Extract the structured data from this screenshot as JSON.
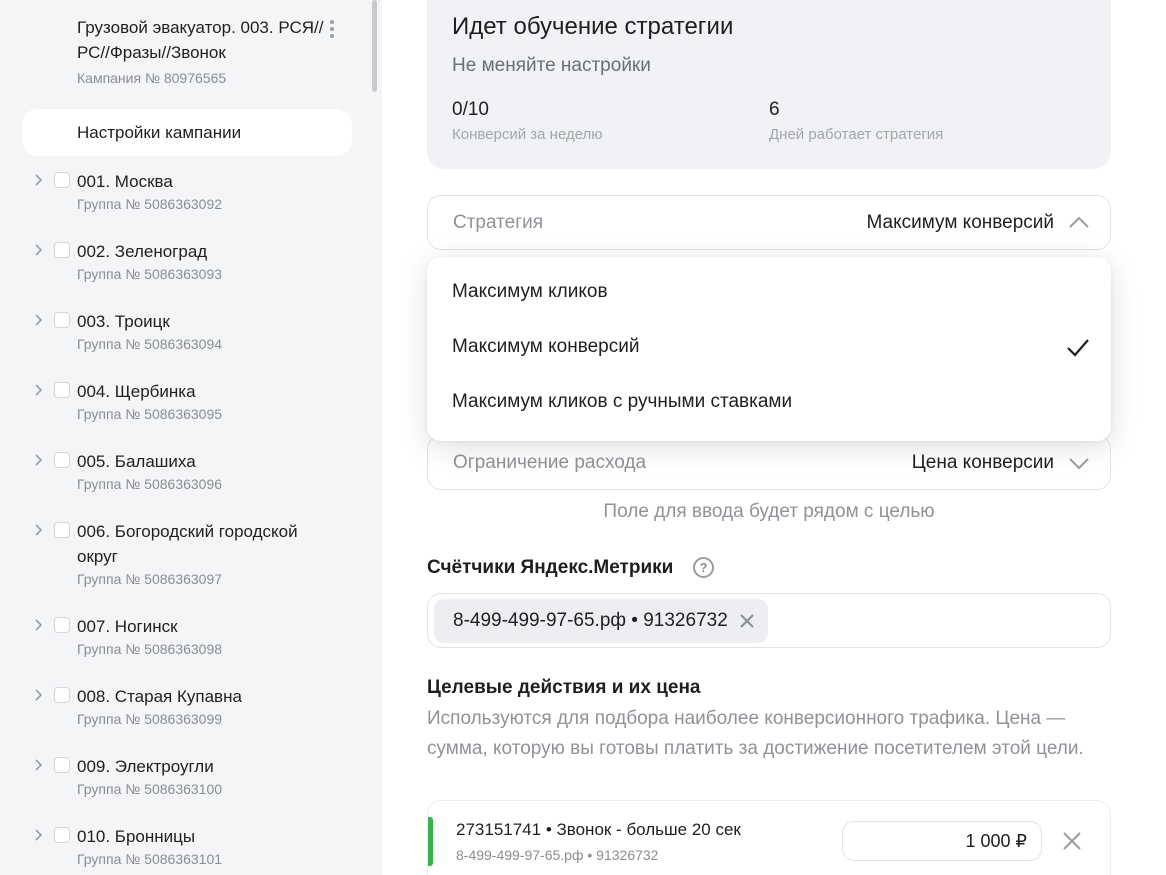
{
  "sidebar": {
    "campaign_title": "Грузовой эвакуатор. 003. РСЯ//РС//Фразы//Звонок",
    "campaign_id": "Кампания № 80976565",
    "settings_label": "Настройки кампании",
    "groups": [
      {
        "name": "001. Москва",
        "id": "Группа № 5086363092"
      },
      {
        "name": "002. Зеленоград",
        "id": "Группа № 5086363093"
      },
      {
        "name": "003. Троицк",
        "id": "Группа № 5086363094"
      },
      {
        "name": "004. Щербинка",
        "id": "Группа № 5086363095"
      },
      {
        "name": "005. Балашиха",
        "id": "Группа № 5086363096"
      },
      {
        "name": "006. Богородский городской округ",
        "id": "Группа № 5086363097"
      },
      {
        "name": "007. Ногинск",
        "id": "Группа № 5086363098"
      },
      {
        "name": "008. Старая Купавна",
        "id": "Группа № 5086363099"
      },
      {
        "name": "009. Электроугли",
        "id": "Группа № 5086363100"
      },
      {
        "name": "010. Бронницы",
        "id": "Группа № 5086363101"
      }
    ]
  },
  "learning": {
    "title": "Идет обучение стратегии",
    "subtitle": "Не меняйте настройки",
    "conversions_value": "0/10",
    "conversions_label": "Конверсий за неделю",
    "days_value": "6",
    "days_label": "Дней работает стратегия"
  },
  "strategy": {
    "label": "Стратегия",
    "value": "Максимум конверсий",
    "options": [
      "Максимум кликов",
      "Максимум конверсий",
      "Максимум кликов с ручными ставками"
    ],
    "selected_index": 1
  },
  "spend_limit": {
    "label": "Ограничение расхода",
    "value": "Цена конверсии"
  },
  "hint": "Поле для ввода будет рядом с целью",
  "metrika": {
    "title": "Счётчики Яндекс.Метрики",
    "help": "?",
    "chip": "8-499-499-97-65.рф • 91326732"
  },
  "goals": {
    "title": "Целевые действия и их цена",
    "description": "Используются для подбора наиболее конверсионного трафика. Цена — сумма, которую вы готовы платить за достижение посетителем этой цели.",
    "items": [
      {
        "name": "273151741 • Звонок - больше 20 сек",
        "source": "8-499-499-97-65.рф • 91326732",
        "price": "1 000 ₽"
      }
    ]
  },
  "colors": {
    "accent_green": "#37b24d",
    "sidebar_bg": "#f4f5f7",
    "card_bg": "#f1f2f5"
  }
}
